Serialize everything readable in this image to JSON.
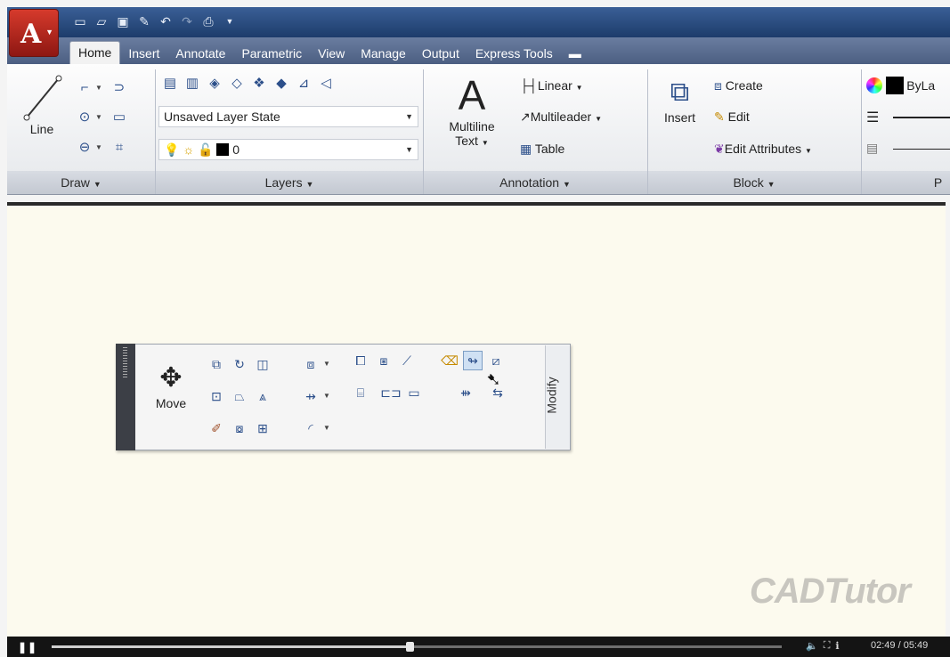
{
  "app": {
    "logo_letter": "A"
  },
  "quick_access": {
    "icons": [
      "new-icon",
      "open-icon",
      "save-icon",
      "save-as-icon",
      "undo-icon",
      "redo-icon",
      "plot-icon"
    ]
  },
  "tabs": [
    "Home",
    "Insert",
    "Annotate",
    "Parametric",
    "View",
    "Manage",
    "Output",
    "Express Tools"
  ],
  "tab_extra_icon": "panel-toggle-icon",
  "draw": {
    "line_label": "Line",
    "panel_title": "Draw"
  },
  "layers": {
    "layer_state": "Unsaved Layer State",
    "current_layer": "0",
    "panel_title": "Layers"
  },
  "annotation": {
    "multiline_text_l1": "Multiline",
    "multiline_text_l2": "Text",
    "linear": "Linear",
    "multileader": "Multileader",
    "table": "Table",
    "panel_title": "Annotation"
  },
  "block": {
    "insert": "Insert",
    "create": "Create",
    "edit": "Edit",
    "edit_attributes": "Edit Attributes",
    "panel_title": "Block"
  },
  "properties": {
    "color_value": "ByLa",
    "panel_title_partial": "P"
  },
  "modify": {
    "move": "Move",
    "title": "Modify"
  },
  "watermark": "CADTutor",
  "video": {
    "time": "02:49 / 05:49",
    "progress_fraction": 0.49
  }
}
